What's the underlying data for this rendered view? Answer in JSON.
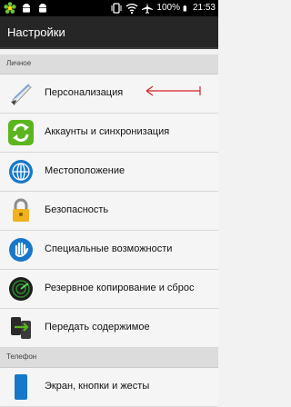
{
  "status_bar": {
    "battery": "100%",
    "time": "21:53",
    "icons": [
      "icq-icon",
      "android-icon",
      "android-icon",
      "vibrate-icon",
      "wifi-icon",
      "airplane-icon",
      "battery-icon"
    ]
  },
  "header": {
    "title": "Настройки"
  },
  "sections": [
    {
      "title": "Личное"
    },
    {
      "title": "Телефон"
    }
  ],
  "items": [
    {
      "label": "Персонализация",
      "icon": "paintbrush-icon"
    },
    {
      "label": "Аккаунты и синхронизация",
      "icon": "sync-icon"
    },
    {
      "label": "Местоположение",
      "icon": "location-globe-icon"
    },
    {
      "label": "Безопасность",
      "icon": "lock-icon"
    },
    {
      "label": "Специальные возможности",
      "icon": "hand-icon"
    },
    {
      "label": "Резервное копирование и сброс",
      "icon": "backup-radar-icon"
    },
    {
      "label": "Передать содержимое",
      "icon": "transfer-phones-icon"
    },
    {
      "label": "Экран, кнопки и жесты",
      "icon": "phone-icon"
    }
  ],
  "annotation_color": "#d6232a"
}
